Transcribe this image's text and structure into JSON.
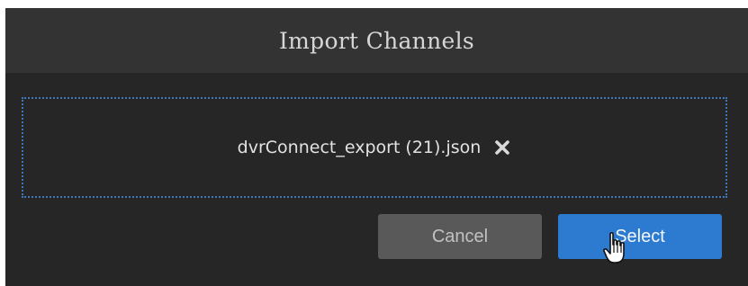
{
  "dialog": {
    "title": "Import Channels",
    "file": {
      "name": "dvrConnect_export (21).json",
      "remove_icon": "close-x-icon"
    },
    "buttons": {
      "cancel_label": "Cancel",
      "select_label": "Select"
    }
  },
  "cursor": {
    "icon": "hand-pointer-icon"
  },
  "colors": {
    "header_bg": "#333333",
    "dialog_bg": "#262626",
    "dropzone_border": "#3f78b8",
    "cancel_bg": "#595959",
    "select_bg": "#2c7bd1"
  }
}
